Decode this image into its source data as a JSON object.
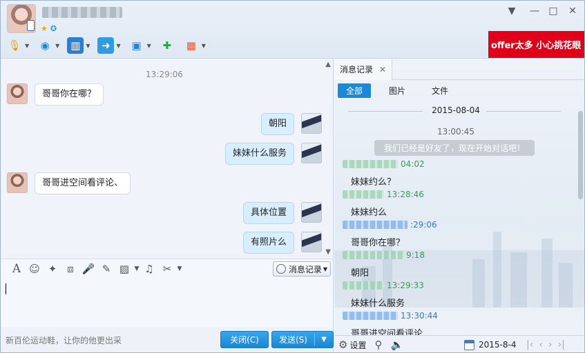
{
  "app": {
    "contact_name": "",
    "window_controls": [
      "▼",
      "—",
      "□",
      "✕"
    ]
  },
  "toolbar": {
    "tools": [
      {
        "name": "voice-call-icon",
        "glyph": "🎙"
      },
      {
        "name": "video-call-icon",
        "glyph": "◉"
      },
      {
        "name": "screen-share-icon",
        "glyph": "▥"
      },
      {
        "name": "send-file-icon",
        "glyph": "➜"
      },
      {
        "name": "remote-desktop-icon",
        "glyph": "▣"
      },
      {
        "name": "chat-add-icon",
        "glyph": "✚"
      },
      {
        "name": "apps-icon",
        "glyph": "▦"
      }
    ]
  },
  "ad_banner": "offer太多 小心挑花眼",
  "chat": {
    "time": "13:29:06",
    "messages": [
      {
        "direction": "in",
        "text": "哥哥你在哪？"
      },
      {
        "direction": "out",
        "text": "朝阳"
      },
      {
        "direction": "out",
        "text": "妹妹什么服务"
      },
      {
        "direction": "in",
        "text": "哥哥进空间看评论、"
      },
      {
        "direction": "out",
        "text": "具体位置"
      },
      {
        "direction": "out",
        "text": "有照片么"
      }
    ]
  },
  "input_toolbar": {
    "history_label": "消息记录",
    "tools": [
      {
        "name": "font-icon",
        "glyph": "A"
      },
      {
        "name": "emoji-icon",
        "glyph": "☺"
      },
      {
        "name": "magic-icon",
        "glyph": "✦"
      },
      {
        "name": "shake-icon",
        "glyph": "⧈"
      },
      {
        "name": "voice-message-icon",
        "glyph": "🎤"
      },
      {
        "name": "doodle-icon",
        "glyph": "✎"
      },
      {
        "name": "image-icon",
        "glyph": "▨"
      },
      {
        "name": "music-icon",
        "glyph": "♫"
      },
      {
        "name": "screenshot-icon",
        "glyph": "✂"
      }
    ]
  },
  "footer": {
    "ad_text": "新百伦运动鞋，让你的他更出采",
    "close_label": "关闭(C)",
    "send_label": "发送(S)"
  },
  "history": {
    "tab_label": "消息记录",
    "filters": [
      "全部",
      "图片",
      "文件"
    ],
    "date": "2015-08-04",
    "first_time": "13:00:45",
    "system_message": "我们已经是好友了，现在开始对话吧！",
    "entries": [
      {
        "time": "04:02",
        "color": "green",
        "text": "妹妹约么？"
      },
      {
        "time": "13:28:46",
        "color": "green",
        "text": "妹妹约么"
      },
      {
        "time": ":29:06",
        "color": "blue",
        "text": "哥哥你在哪？"
      },
      {
        "time": "9:18",
        "color": "green",
        "text": "朝阳"
      },
      {
        "time": "13:29:33",
        "color": "green",
        "text": "妹妹什么服务"
      },
      {
        "time": "13:30:44",
        "color": "blue",
        "text": "哥哥进空间看评论"
      }
    ],
    "footer_settings": "设置",
    "footer_date": "2015-8-4",
    "nav": [
      "|‹",
      "‹",
      "›",
      "›|"
    ]
  }
}
